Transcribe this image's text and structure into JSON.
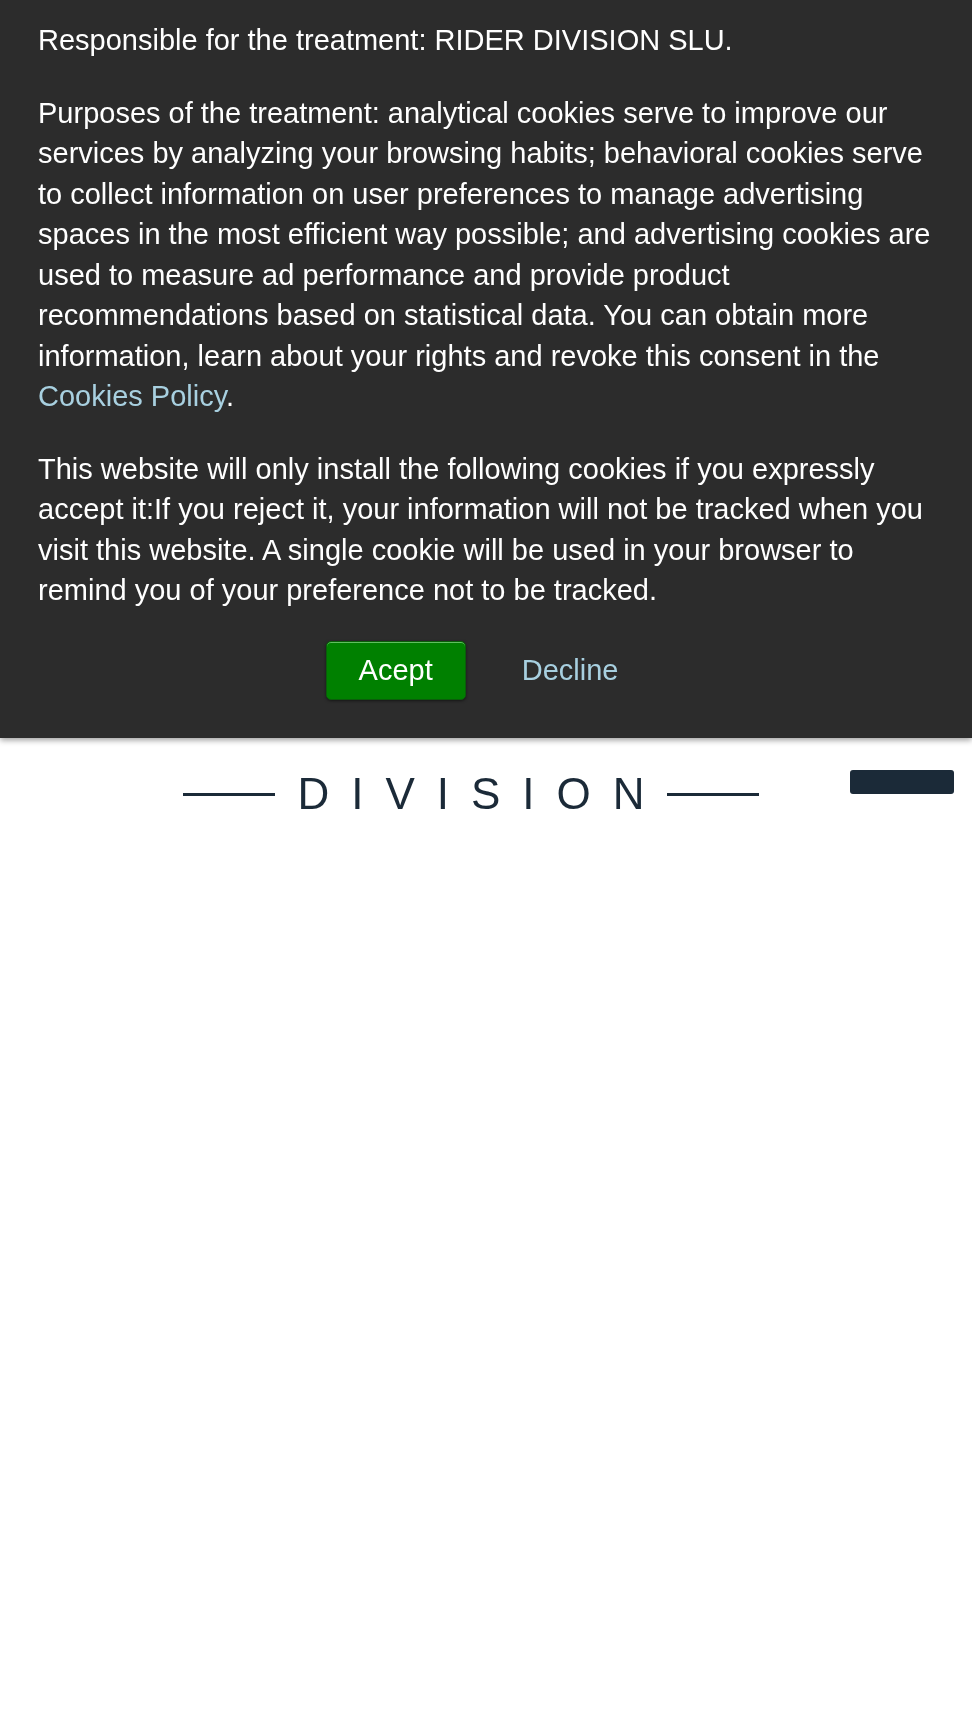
{
  "cookie_banner": {
    "paragraphs": [
      "Responsible for the treatment: RIDER DIVISION SLU.",
      "Purposes of the treatment: analytical cookies serve to improve our services by analyzing your browsing habits; behavioral cookies serve to collect information on user preferences to manage advertising spaces in the most efficient way possible; and advertising cookies are used to measure ad performance and provide product recommendations based on statistical data. You can obtain more information, learn about your rights and revoke this consent in the ",
      "This website will only install the following cookies if you expressly accept it:If you reject it, your information will not be tracked when you visit this website. A single cookie will be used in your browser to remind you of your preference not to be tracked."
    ],
    "policy_link": "Cookies Policy",
    "policy_suffix": ".",
    "buttons": [
      {
        "label": "Acept",
        "kind": "primary"
      },
      {
        "label": "Decline",
        "kind": "link"
      }
    ]
  },
  "header": {
    "logo_text": "DIVISION"
  }
}
